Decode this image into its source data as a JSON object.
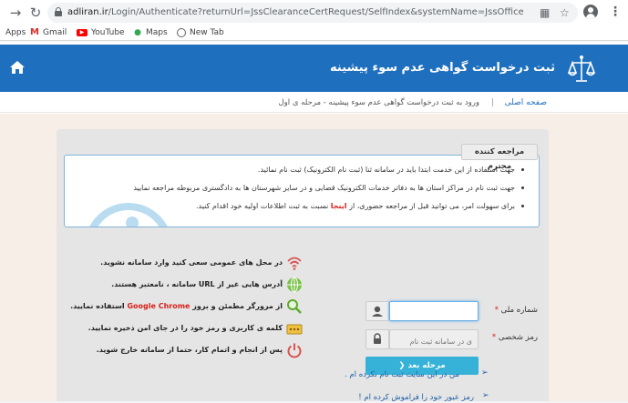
{
  "browser": {
    "url_host": "adliran.ir",
    "url_path": "/Login/Authenticate?returnUrl=JssClearanceCertRequest/SelfIndex&systemName=JssOfficeService&loginTy...",
    "bookmarks": [
      {
        "label": "Apps",
        "icon": "apps-icon"
      },
      {
        "label": "Gmail",
        "icon": "gmail-icon"
      },
      {
        "label": "YouTube",
        "icon": "youtube-icon"
      },
      {
        "label": "Maps",
        "icon": "maps-icon"
      },
      {
        "label": "New Tab",
        "icon": "new-tab-icon"
      }
    ]
  },
  "site": {
    "title": "ثبت درخواست گواهی عدم سوء پیشینه",
    "breadcrumb": {
      "home": "صفحه اصلی",
      "current": "ورود به ثبت درخواست گواهی عدم سوء پیشینه - مرحله ی اول"
    },
    "notice": {
      "tab": "مراجعه کننده محترم",
      "items": [
        "جهت استفاده از این خدمت ابتدا باید در سامانه ثنا (ثبت نام الکترونیک) ثبت نام نمائید.",
        "جهت ثبت نام در مراکز استان ها به دفاتر خدمات الکترونیک قضایی و در سایر شهرستان ها به دادگستری مربوطه مراجعه نمایید"
      ],
      "item3_before": "برای سهولت امر، می توانید قبل از مراجعه حضوری، از ",
      "item3_link": "اینجا",
      "item3_after": " نسبت به ثبت اطلاعات اولیه خود اقدام کنید."
    },
    "tips": [
      {
        "icon": "wifi-warning-icon",
        "text": "در محل های عمومی سعی کنید وارد سامانه نشوید."
      },
      {
        "icon": "globe-icon",
        "text": "آدرس هایی غیر از URL سامانه ، نامعتبر هستند."
      },
      {
        "icon": "magnifier-icon",
        "text_before": "از مرورگر مطمئن و بروز ",
        "text_red": "Google Chrome",
        "text_after": " استفاده نمایید."
      },
      {
        "icon": "password-icon",
        "text": "کلمه ی کاربری و رمز خود را در جای امن ذخیره نمایید."
      },
      {
        "icon": "power-icon",
        "text": "پس از انجام و اتمام کار، حتما از سامانه خارج شوید."
      }
    ],
    "form": {
      "national_id_label": "شماره ملی",
      "password_label": "رمز شخصی",
      "required_mark": "*",
      "national_id_value": "",
      "password_placeholder": "ی در سامانه ثبت نام",
      "next_button": "مرحله بعد"
    },
    "links": {
      "forgot_password": "رمز عبور خود را فراموش کرده ام !",
      "not_registered": "من در این سایت ثبت نام نکرده ام ."
    }
  }
}
